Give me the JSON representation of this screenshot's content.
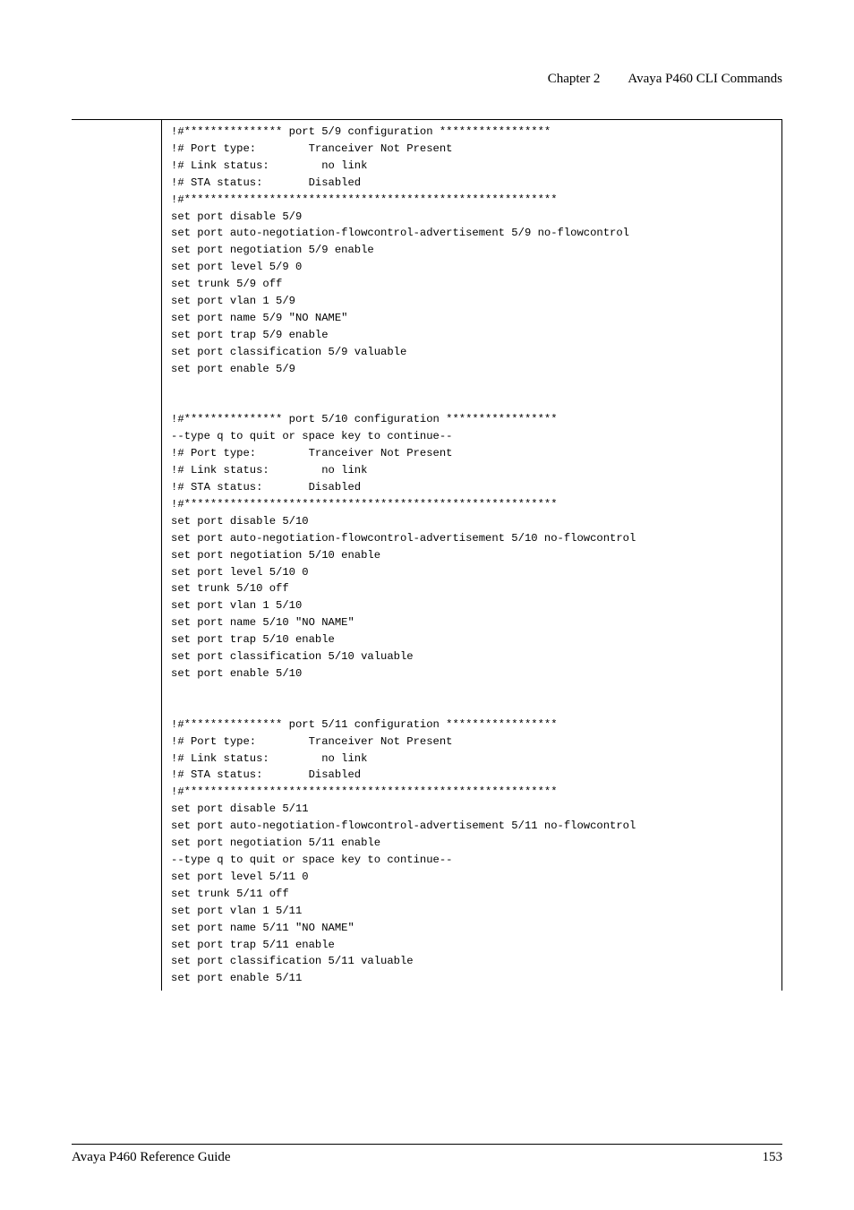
{
  "header": {
    "chapter": "Chapter 2",
    "title": "Avaya P460 CLI Commands"
  },
  "code": "!#*************** port 5/9 configuration *****************\n!# Port type:        Tranceiver Not Present\n!# Link status:        no link\n!# STA status:       Disabled\n!#*********************************************************\nset port disable 5/9\nset port auto-negotiation-flowcontrol-advertisement 5/9 no-flowcontrol\nset port negotiation 5/9 enable\nset port level 5/9 0\nset trunk 5/9 off\nset port vlan 1 5/9\nset port name 5/9 \"NO NAME\"\nset port trap 5/9 enable\nset port classification 5/9 valuable\nset port enable 5/9\n\n\n!#*************** port 5/10 configuration *****************\n--type q to quit or space key to continue-- \n!# Port type:        Tranceiver Not Present\n!# Link status:        no link\n!# STA status:       Disabled\n!#*********************************************************\nset port disable 5/10\nset port auto-negotiation-flowcontrol-advertisement 5/10 no-flowcontrol\nset port negotiation 5/10 enable\nset port level 5/10 0\nset trunk 5/10 off\nset port vlan 1 5/10\nset port name 5/10 \"NO NAME\"\nset port trap 5/10 enable\nset port classification 5/10 valuable\nset port enable 5/10\n\n\n!#*************** port 5/11 configuration *****************\n!# Port type:        Tranceiver Not Present\n!# Link status:        no link\n!# STA status:       Disabled\n!#*********************************************************\nset port disable 5/11\nset port auto-negotiation-flowcontrol-advertisement 5/11 no-flowcontrol\nset port negotiation 5/11 enable\n--type q to quit or space key to continue-- \nset port level 5/11 0\nset trunk 5/11 off\nset port vlan 1 5/11\nset port name 5/11 \"NO NAME\"\nset port trap 5/11 enable\nset port classification 5/11 valuable\nset port enable 5/11\n",
  "footer": {
    "left": "Avaya P460 Reference Guide",
    "right": "153"
  }
}
